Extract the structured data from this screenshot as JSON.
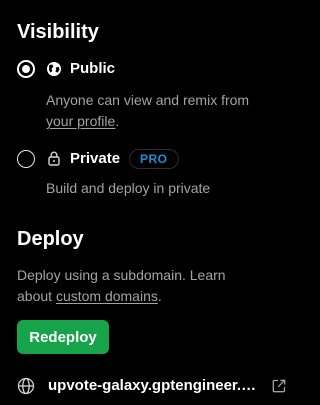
{
  "visibility": {
    "title": "Visibility",
    "options": [
      {
        "label": "Public",
        "selected": true,
        "icon": "globe-icon",
        "description_prefix": "Anyone can view and remix from",
        "description_link": "your profile",
        "description_suffix": "."
      },
      {
        "label": "Private",
        "selected": false,
        "icon": "lock-icon",
        "badge": "PRO",
        "description": "Build and deploy in private"
      }
    ]
  },
  "deploy": {
    "title": "Deploy",
    "description_line1": "Deploy using a subdomain. Learn",
    "description_prefix": "about",
    "description_link": "custom domains",
    "description_suffix": ".",
    "button_label": "Redeploy",
    "domain": "upvote-galaxy.gptengineer.app",
    "domain_icon": "globe-icon",
    "external_link_icon": "external-link-icon"
  },
  "colors": {
    "background": "#000000",
    "text_primary": "#ffffff",
    "text_secondary": "#a3a3a3",
    "badge_text": "#1d8fd6",
    "button_bg": "#16a34a"
  }
}
